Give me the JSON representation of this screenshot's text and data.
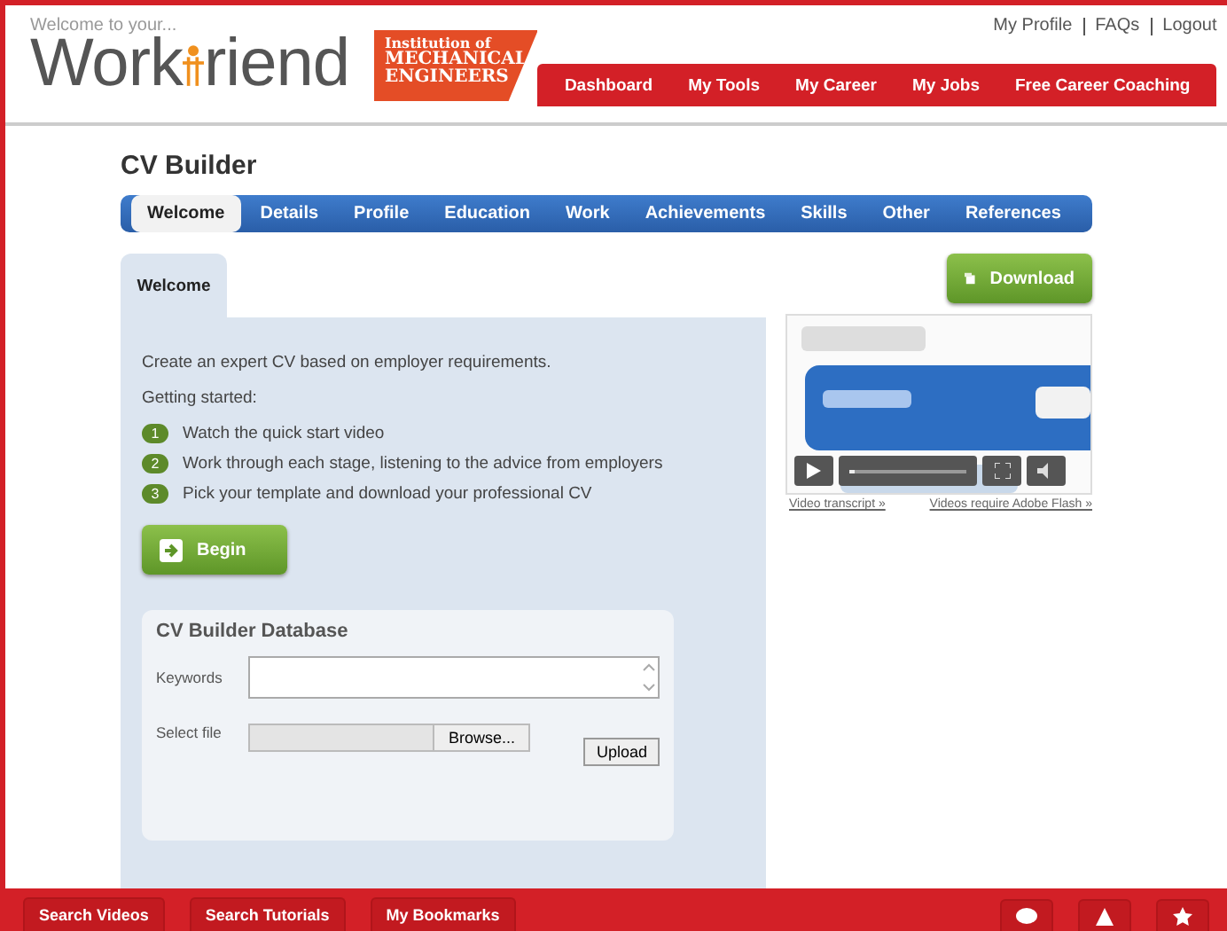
{
  "header": {
    "tagline": "Welcome to your...",
    "logo_left": "Work",
    "logo_right": "riend",
    "partner_logo": [
      "Institution of",
      "MECHANICAL",
      "ENGINEERS"
    ],
    "top_links": [
      "My Profile",
      "FAQs",
      "Logout"
    ],
    "nav": [
      "Dashboard",
      "My Tools",
      "My Career",
      "My Jobs",
      "Free Career Coaching"
    ]
  },
  "page_title": "CV Builder",
  "tabs": [
    {
      "label": "Welcome",
      "selected": true
    },
    {
      "label": "Details",
      "selected": false
    },
    {
      "label": "Profile",
      "selected": false
    },
    {
      "label": "Education",
      "selected": false
    },
    {
      "label": "Work",
      "selected": false
    },
    {
      "label": "Achievements",
      "selected": false
    },
    {
      "label": "Skills",
      "selected": false
    },
    {
      "label": "Other",
      "selected": false
    },
    {
      "label": "References",
      "selected": false
    }
  ],
  "panel": {
    "tab": "Welcome",
    "intro": "Create an expert CV based on employer requirements.",
    "getting_started": "Getting started:",
    "steps": [
      {
        "number": "1",
        "text": "Watch the quick start video"
      },
      {
        "number": "2",
        "text": "Work through each stage, listening to the advice from employers"
      },
      {
        "number": "3",
        "text": "Pick your template and download your professional CV"
      }
    ],
    "begin_button": "Begin"
  },
  "database": {
    "title": "CV Builder Database",
    "keywords_label": "Keywords",
    "file_label": "Select file",
    "browse_button": "Browse...",
    "upload_button": "Upload"
  },
  "download_button": "Download",
  "video": {
    "kind": "picture",
    "progress": {
      "level": 0.05
    },
    "links": [
      "Video transcript »",
      "Videos require Adobe Flash »"
    ]
  },
  "footer": {
    "buttons": [
      "Search Videos",
      "Search Tutorials",
      "My Bookmarks"
    ]
  }
}
